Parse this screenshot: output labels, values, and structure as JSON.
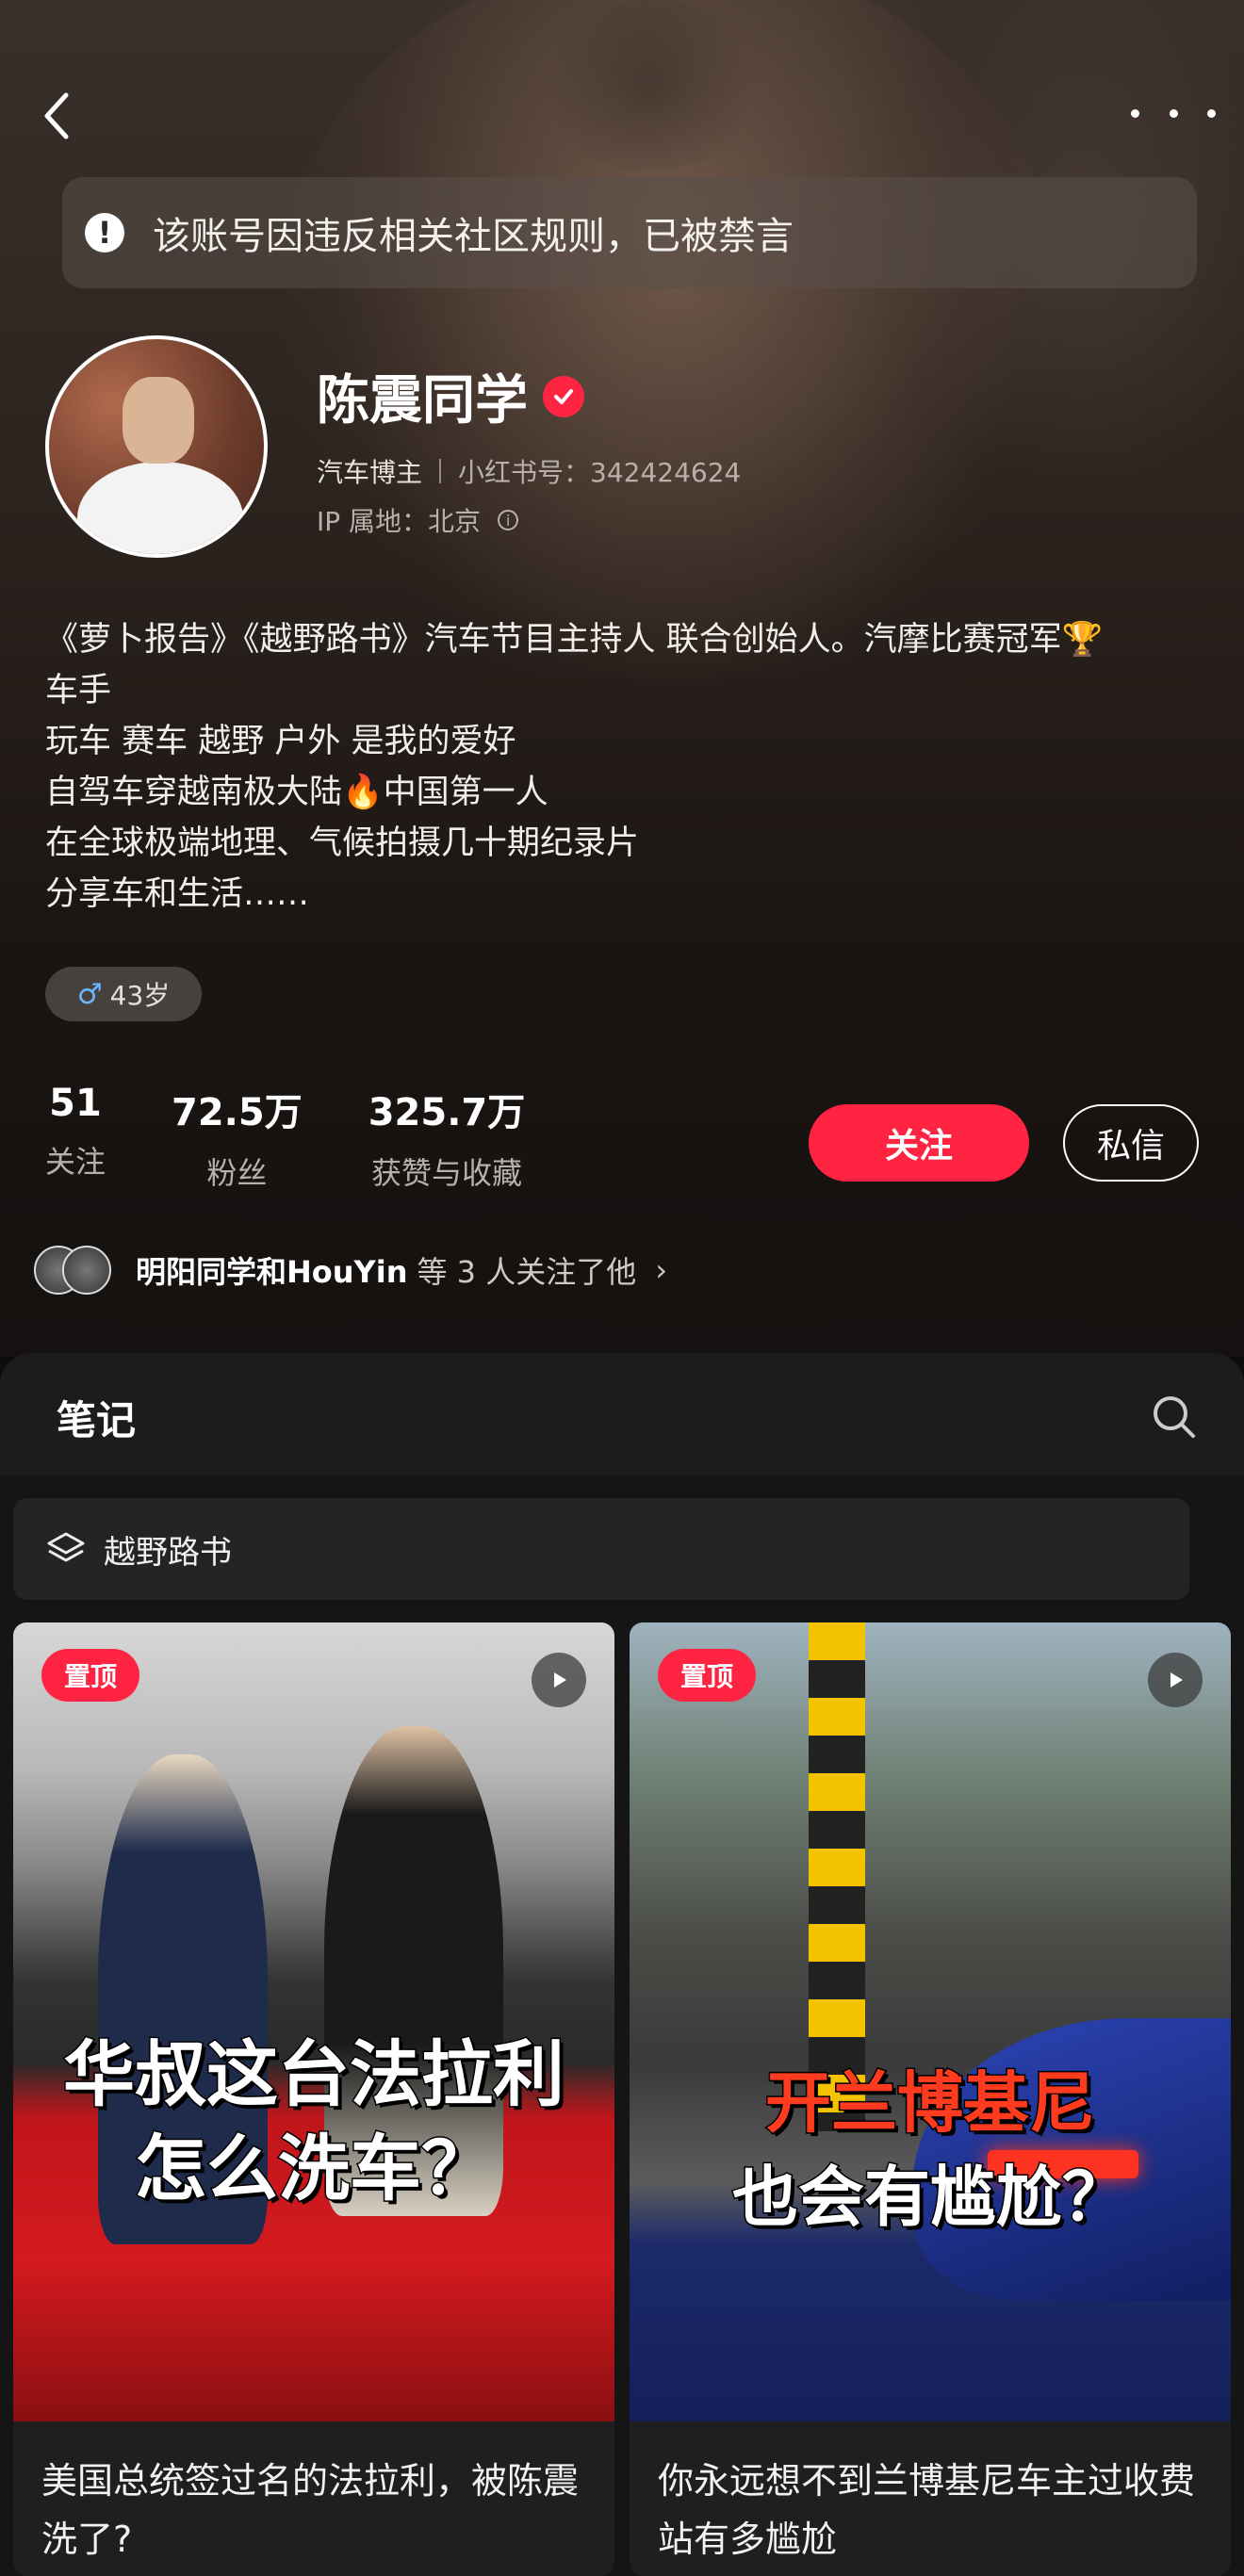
{
  "banner": {
    "text": "该账号因违反相关社区规则，已被禁言"
  },
  "profile": {
    "name": "陈震同学",
    "role": "汽车博主",
    "id_label": "小红书号：342424624",
    "ip_location": "IP 属地：北京",
    "bio_lines": [
      "《萝卜报告》《越野路书》汽车节目主持人 联合创始人。汽摩比赛冠军🏆",
      "车手",
      "玩车 赛车 越野 户外 是我的爱好",
      "自驾车穿越南极大陆🔥中国第一人",
      "在全球极端地理、气候拍摄几十期纪录片",
      "分享车和生活……"
    ],
    "age_tag": "43岁",
    "age_symbol": "♂"
  },
  "stats": [
    {
      "value": "51",
      "label": "关注"
    },
    {
      "value": "72.5万",
      "label": "粉丝"
    },
    {
      "value": "325.7万",
      "label": "获赞与收藏"
    }
  ],
  "actions": {
    "follow": "关注",
    "message": "私信"
  },
  "mutual": {
    "names": "明阳同学和HouYin",
    "suffix": "等 3 人关注了他"
  },
  "notes": {
    "tab_title": "笔记",
    "collection": "越野路书",
    "cards": [
      {
        "pin": "置顶",
        "overlay_lines": [
          "华叔这台法拉利",
          "怎么洗车？"
        ],
        "caption": "美国总统签过名的法拉利，被陈震洗了?"
      },
      {
        "pin": "置顶",
        "overlay_lines": [
          "开兰博基尼",
          "也会有尴尬？"
        ],
        "caption": "你永远想不到兰博基尼车主过收费站有多尴尬"
      }
    ]
  },
  "colors": {
    "accent": "#ff2442",
    "background": "#0f0d0c",
    "panel": "#151515"
  }
}
